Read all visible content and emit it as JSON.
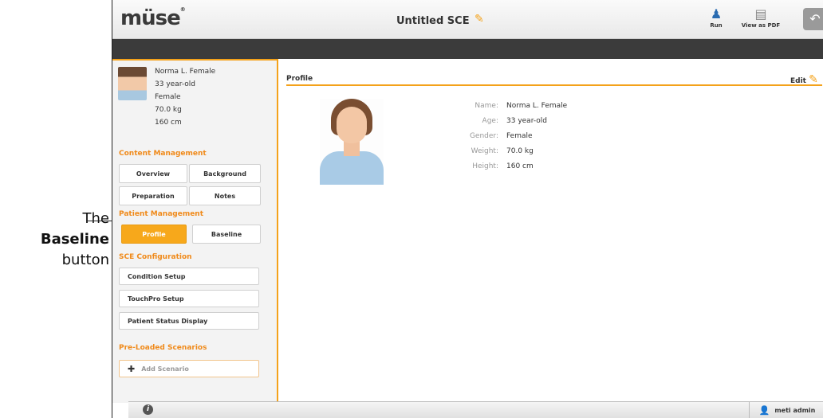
{
  "callout": {
    "line1": "The",
    "line2": "Baseline",
    "line3": "button"
  },
  "topbar": {
    "logo": "müse",
    "logo_mark": "®",
    "doc_title": "Untitled SCE",
    "run_label": "Run",
    "pdf_label": "View as PDF"
  },
  "patient": {
    "name": "Norma L. Female",
    "age": "33 year-old",
    "gender": "Female",
    "weight": "70.0 kg",
    "height": "160 cm"
  },
  "sidebar": {
    "content_heading": "Content Management",
    "overview": "Overview",
    "background": "Background",
    "preparation": "Preparation",
    "notes": "Notes",
    "patient_heading": "Patient Management",
    "profile": "Profile",
    "baseline": "Baseline",
    "sce_heading": "SCE Configuration",
    "condition_setup": "Condition Setup",
    "touchpro_setup": "TouchPro Setup",
    "patient_status": "Patient Status Display",
    "preloaded_heading": "Pre-Loaded Scenarios",
    "add_scenario": "Add Scenario"
  },
  "main": {
    "section_title": "Profile",
    "edit_label": "Edit",
    "labels": {
      "name": "Name:",
      "age": "Age:",
      "gender": "Gender:",
      "weight": "Weight:",
      "height": "Height:"
    }
  },
  "statusbar": {
    "user": "meti admin"
  },
  "colors": {
    "accent": "#f4a21a",
    "active_button": "#f7a81b",
    "dark_bar": "#3b3b3b"
  }
}
